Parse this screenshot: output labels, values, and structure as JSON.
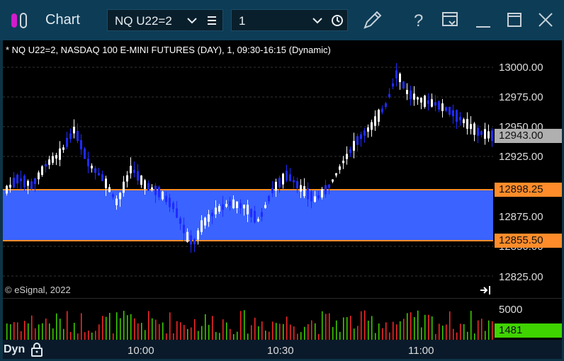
{
  "window": {
    "title": "Chart",
    "symbol_value": "NQ U22=2",
    "interval_value": "1"
  },
  "chart": {
    "header": "* NQ U22=2, NASDAQ 100 E-MINI FUTURES (DAY), 1, 09:30-16:15 (Dynamic)",
    "copyright": "© eSignal, 2022",
    "price_ticks": [
      "13000.00",
      "12975.00",
      "12950.00",
      "12925.00",
      "12875.00",
      "12850.00",
      "12825.00"
    ],
    "last_price_label": "12943.00",
    "zone_high_label": "12898.25",
    "zone_low_label": "12855.50",
    "zone_color": "#3a63ff",
    "zone_border_color": "#ff8c2a",
    "volume_tick": "5000",
    "volume_last_label": "1481",
    "time_ticks": [
      "10:00",
      "10:30",
      "11:00"
    ],
    "dyn_label": "Dyn"
  },
  "colors": {
    "up_candle": "#ffffff",
    "down_candle": "#1f2bff",
    "vol_up": "#3fd400",
    "vol_down": "#ff2a2a"
  }
}
